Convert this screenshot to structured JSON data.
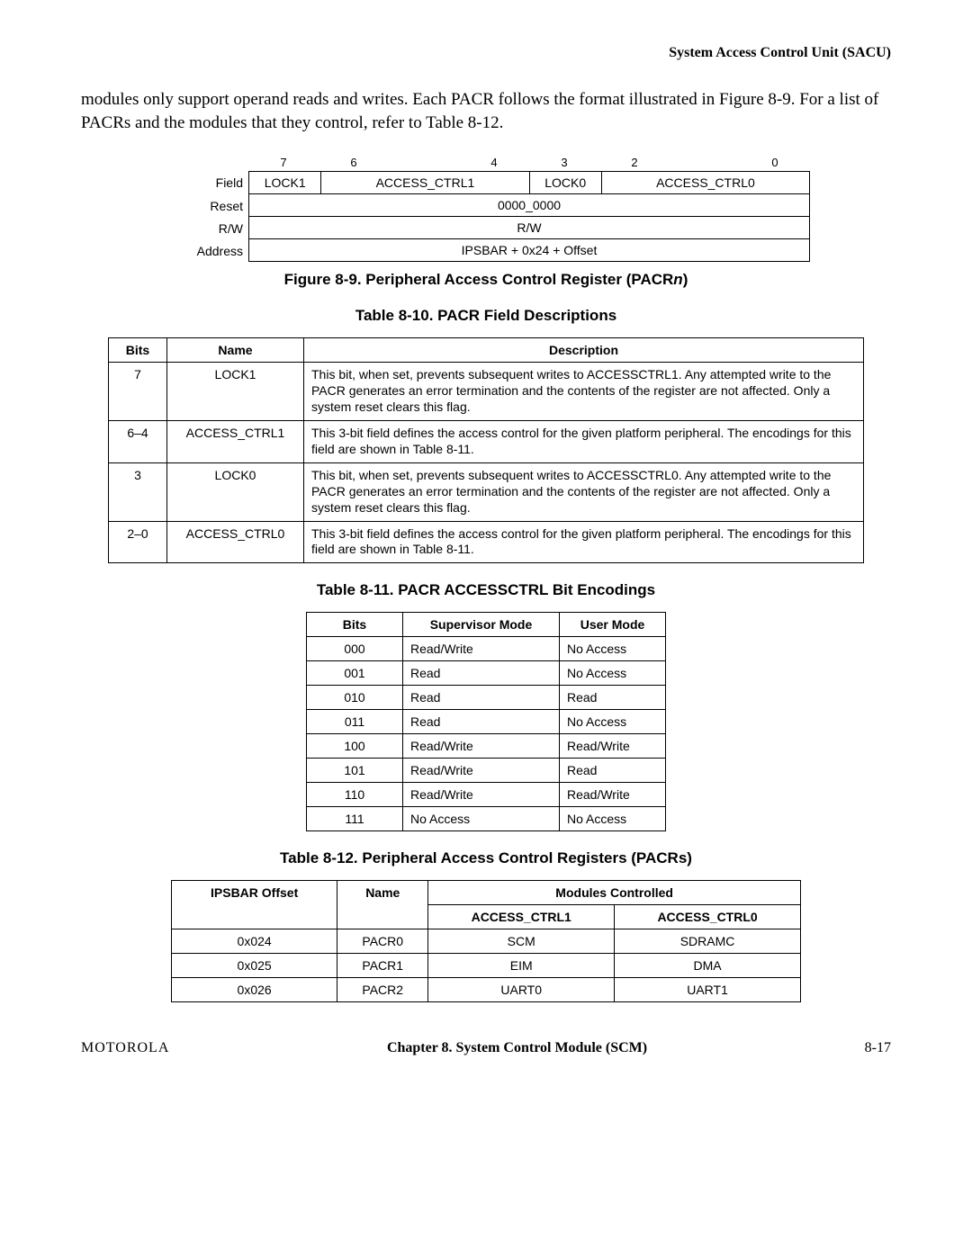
{
  "header": {
    "running_title": "System Access Control Unit (SACU)"
  },
  "body": {
    "para": "modules only support operand reads and writes. Each PACR follows the format illustrated in Figure 8-9. For a list of PACRs and the modules that they control, refer to Table 8-12."
  },
  "fig89": {
    "bit_numbers": [
      "7",
      "6",
      "",
      "4",
      "3",
      "2",
      "",
      "0"
    ],
    "rows": {
      "field_label": "Field",
      "fields": [
        {
          "span": 1,
          "text": "LOCK1"
        },
        {
          "span": 3,
          "text": "ACCESS_CTRL1"
        },
        {
          "span": 1,
          "text": "LOCK0"
        },
        {
          "span": 3,
          "text": "ACCESS_CTRL0"
        }
      ],
      "reset_label": "Reset",
      "reset_value": "0000_0000",
      "rw_label": "R/W",
      "rw_value": "R/W",
      "addr_label": "Address",
      "addr_value": "IPSBAR + 0x24 + Offset"
    },
    "caption_a": "Figure 8-9. Peripheral Access Control Register (PACR",
    "caption_b": "n",
    "caption_c": ")"
  },
  "t10": {
    "caption": "Table 8-10. PACR Field Descriptions",
    "headers": [
      "Bits",
      "Name",
      "Description"
    ],
    "rows": [
      {
        "bits": "7",
        "name": "LOCK1",
        "desc": "This bit, when set, prevents subsequent writes to ACCESSCTRL1. Any attempted write to the PACR generates an error termination and the contents of the register are not affected. Only a system reset clears this flag."
      },
      {
        "bits": "6–4",
        "name": "ACCESS_CTRL1",
        "desc": "This 3-bit field defines the access control for the given platform peripheral. The encodings for this field are shown in Table 8-11."
      },
      {
        "bits": "3",
        "name": "LOCK0",
        "desc": "This bit, when set, prevents subsequent writes to ACCESSCTRL0. Any attempted write to the PACR generates an error termination and the contents of the register are not affected. Only a system reset clears this flag."
      },
      {
        "bits": "2–0",
        "name": "ACCESS_CTRL0",
        "desc": "This 3-bit field defines the access control for the given platform peripheral. The encodings for this field are shown in Table 8-11."
      }
    ]
  },
  "t11": {
    "caption": "Table 8-11. PACR ACCESSCTRL Bit Encodings",
    "headers": [
      "Bits",
      "Supervisor Mode",
      "User Mode"
    ],
    "rows": [
      {
        "bits": "000",
        "sup": "Read/Write",
        "usr": "No Access"
      },
      {
        "bits": "001",
        "sup": "Read",
        "usr": "No Access"
      },
      {
        "bits": "010",
        "sup": "Read",
        "usr": "Read"
      },
      {
        "bits": "011",
        "sup": "Read",
        "usr": "No Access"
      },
      {
        "bits": "100",
        "sup": "Read/Write",
        "usr": "Read/Write"
      },
      {
        "bits": "101",
        "sup": "Read/Write",
        "usr": "Read"
      },
      {
        "bits": "110",
        "sup": "Read/Write",
        "usr": "Read/Write"
      },
      {
        "bits": "111",
        "sup": "No Access",
        "usr": "No Access"
      }
    ]
  },
  "t12": {
    "caption": "Table 8-12. Peripheral Access Control Registers (PACRs)",
    "h_offset": "IPSBAR Offset",
    "h_name": "Name",
    "h_modules": "Modules Controlled",
    "h_c1": "ACCESS_CTRL1",
    "h_c0": "ACCESS_CTRL0",
    "rows": [
      {
        "offset": "0x024",
        "name": "PACR0",
        "c1": "SCM",
        "c0": "SDRAMC"
      },
      {
        "offset": "0x025",
        "name": "PACR1",
        "c1": "EIM",
        "c0": "DMA"
      },
      {
        "offset": "0x026",
        "name": "PACR2",
        "c1": "UART0",
        "c0": "UART1"
      }
    ]
  },
  "footer": {
    "vendor": "MOTOROLA",
    "chapter": "Chapter 8.  System Control Module (SCM)",
    "page": "8-17"
  }
}
